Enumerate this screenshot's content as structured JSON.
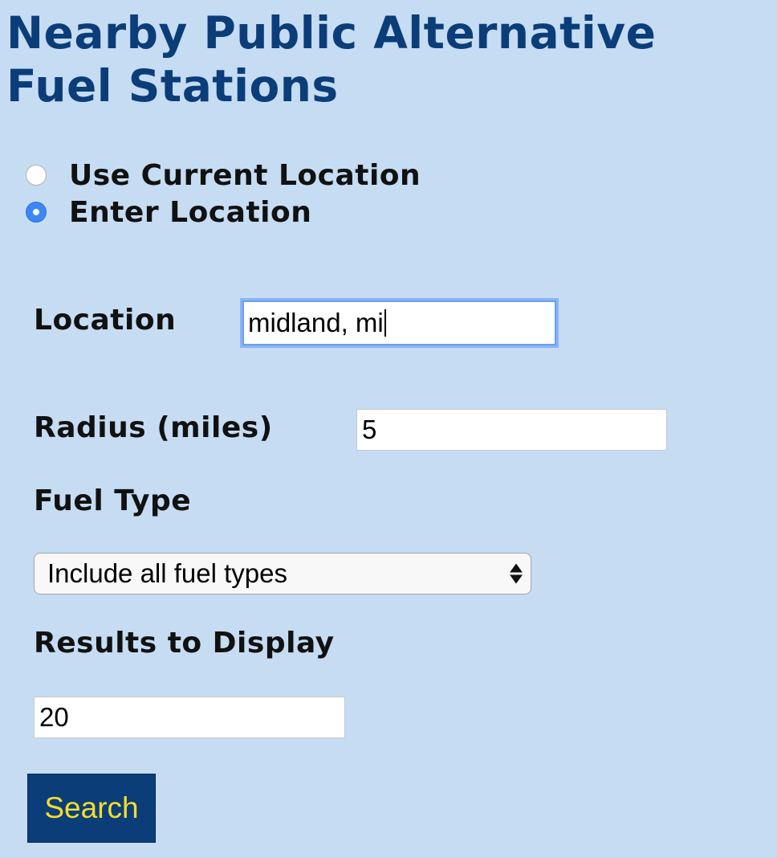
{
  "page": {
    "title": "Nearby Public Alternative Fuel Stations"
  },
  "location_mode": {
    "options": [
      {
        "label": "Use Current Location",
        "selected": false
      },
      {
        "label": "Enter Location",
        "selected": true
      }
    ]
  },
  "form": {
    "location": {
      "label": "Location",
      "value": "midland, mi"
    },
    "radius": {
      "label": "Radius (miles)",
      "value": "5"
    },
    "fuel_type": {
      "label": "Fuel Type",
      "selected": "Include all fuel types"
    },
    "results": {
      "label": "Results to Display",
      "value": "20"
    },
    "search_label": "Search"
  },
  "colors": {
    "background": "#c5dcf3",
    "title": "#0b3d79",
    "button_bg": "#0b3d79",
    "button_text": "#f5dd2b",
    "radio_selected": "#3b88f5"
  }
}
